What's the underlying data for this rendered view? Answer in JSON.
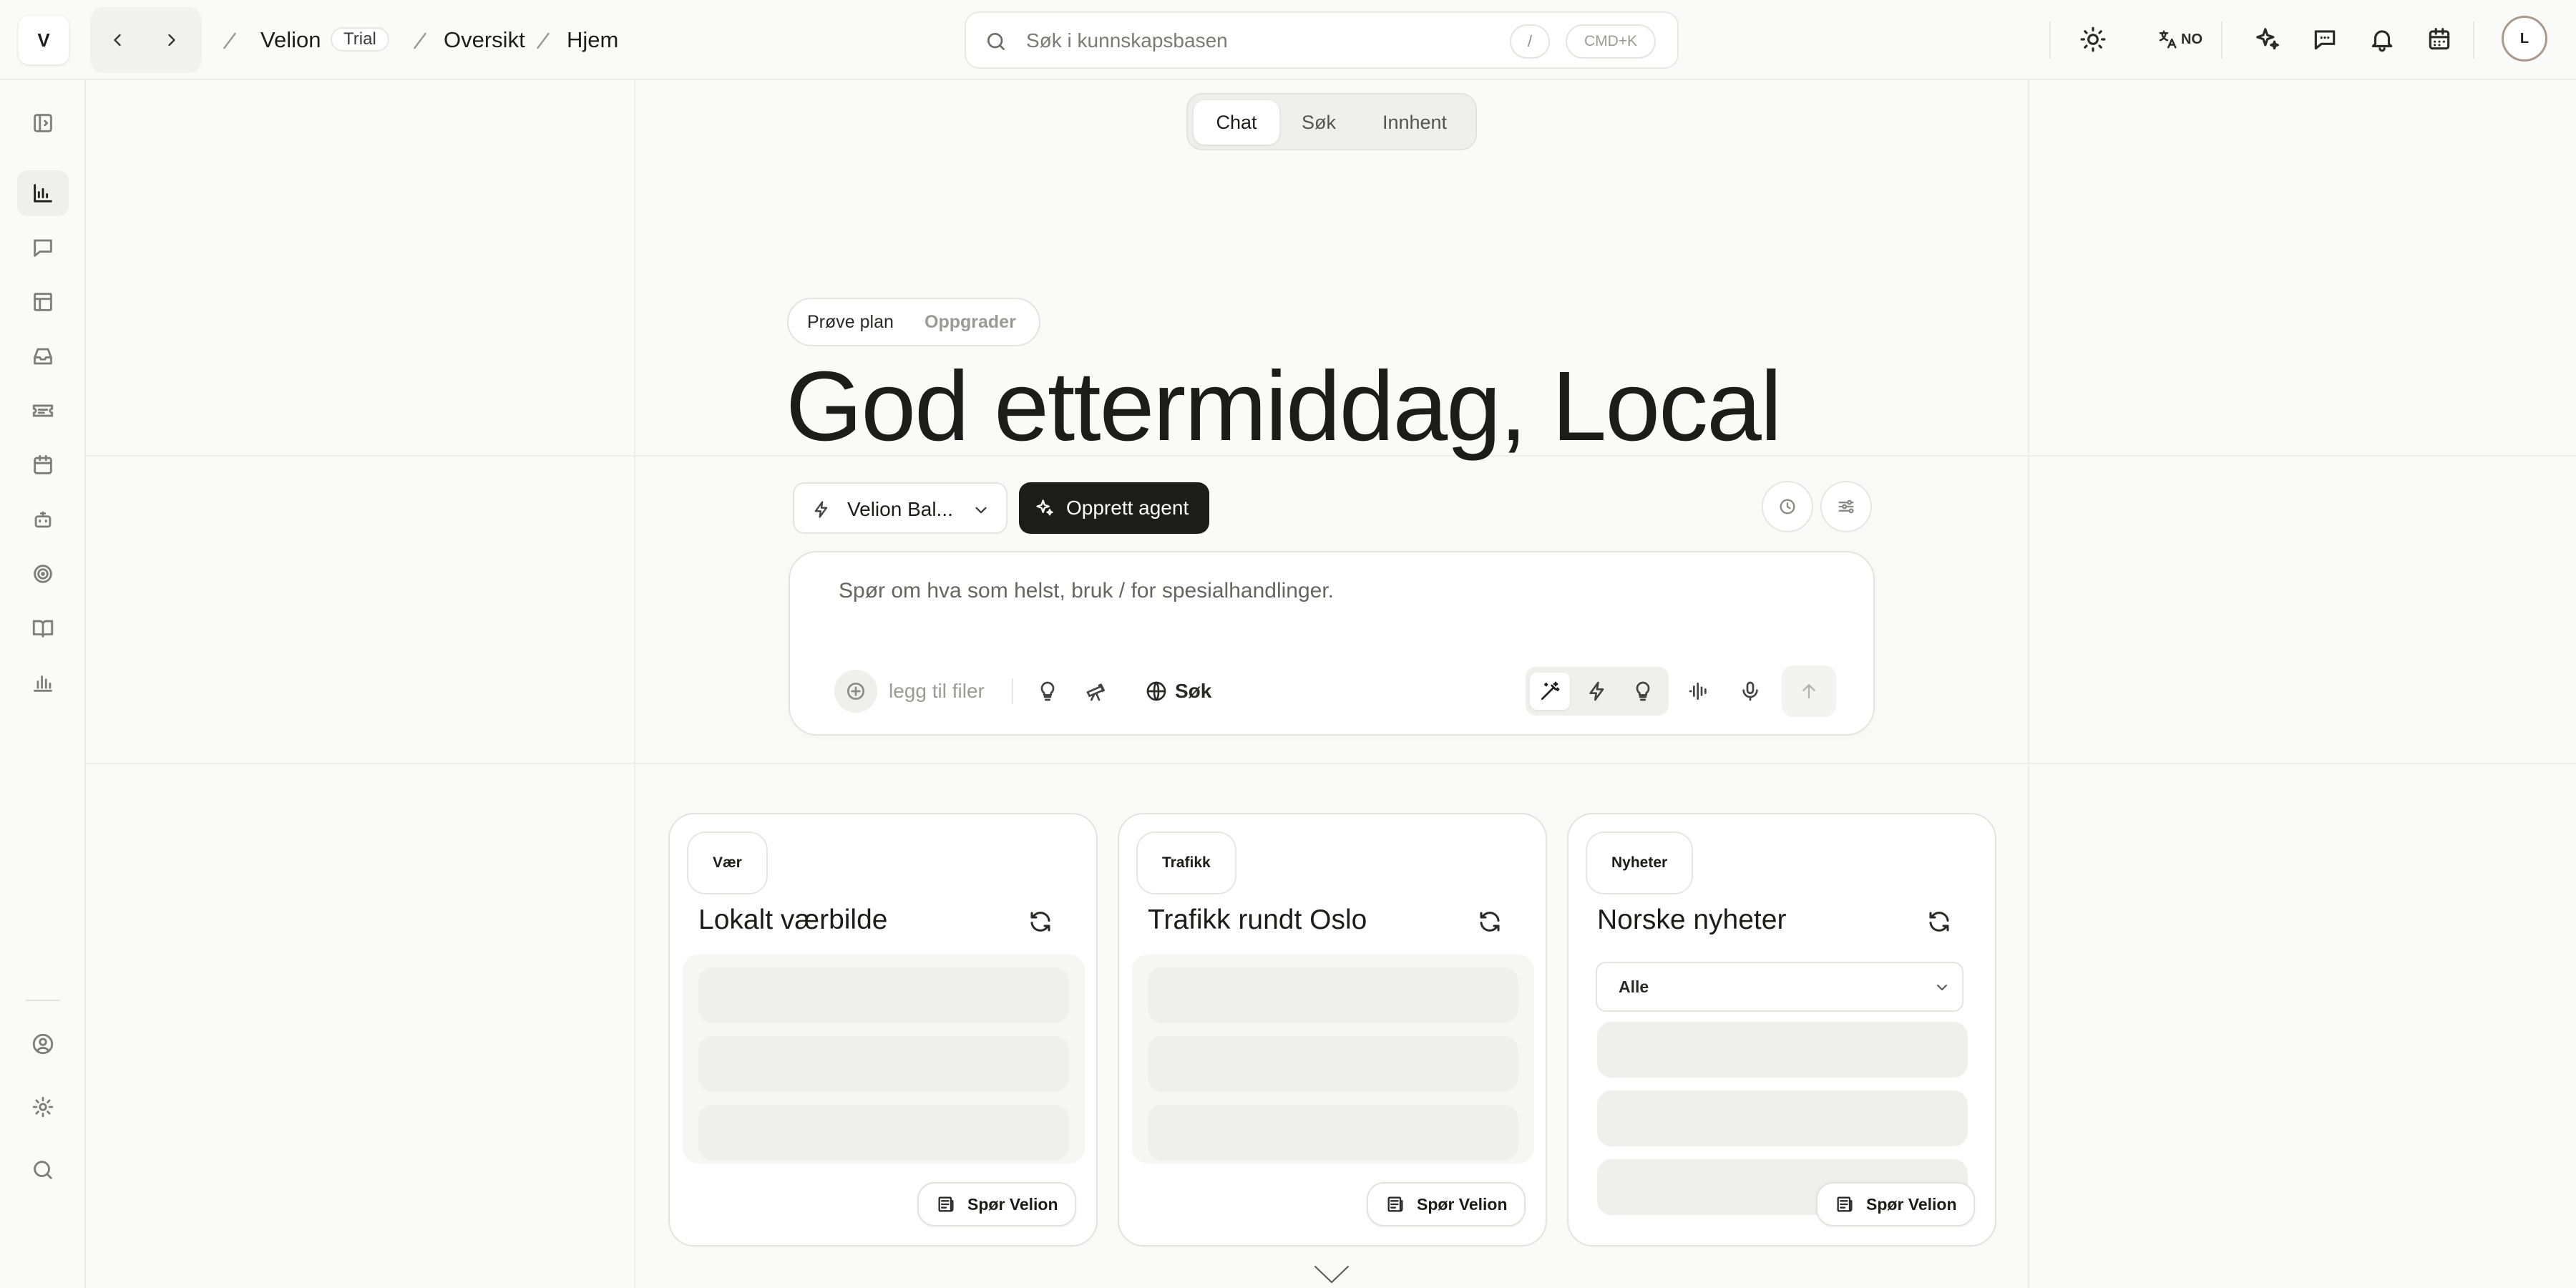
{
  "app": {
    "logo_letter": "V",
    "breadcrumb": {
      "workspace": "Velion",
      "plan_badge": "Trial",
      "section": "Oversikt",
      "page": "Hjem"
    }
  },
  "search": {
    "placeholder": "Søk i kunnskapsbasen",
    "shortcut_slash": "/",
    "shortcut_cmdk": "CMD+K"
  },
  "topbar_icons": [
    "theme-sun-icon",
    "translate-icon",
    "sparkles-icon",
    "chat-bubble-icon",
    "bell-icon",
    "calendar-icon"
  ],
  "language": {
    "code": "NO"
  },
  "user": {
    "avatar_initial": "L"
  },
  "sidebar": {
    "items": [
      "panel-toggle-icon",
      "chart-bar-icon",
      "message-square-icon",
      "table-layout-icon",
      "inbox-icon",
      "ticket-icon",
      "calendar-icon",
      "bot-icon",
      "target-icon",
      "book-open-icon",
      "bar-chart-icon"
    ],
    "active_index": 1,
    "bottom_items": [
      "user-circle-icon",
      "settings-icon",
      "search-icon"
    ]
  },
  "mode_tabs": {
    "items": [
      "Chat",
      "Søk",
      "Innhent"
    ],
    "active": "Chat"
  },
  "plan": {
    "label": "Prøve plan",
    "upgrade": "Oppgrader"
  },
  "greeting": "God ettermiddag, Local",
  "model": {
    "selected": "Velion Bal...",
    "create_agent": "Opprett agent"
  },
  "composer": {
    "placeholder": "Spør om hva som helst, bruk / for spesialhandlinger.",
    "attach_label": "legg til filer",
    "search_label": "Søk"
  },
  "cards": [
    {
      "tag": "Vær",
      "title": "Lokalt værbilde",
      "ask": "Spør Velion"
    },
    {
      "tag": "Trafikk",
      "title": "Trafikk rundt Oslo",
      "ask": "Spør Velion"
    },
    {
      "tag": "Nyheter",
      "title": "Norske nyheter",
      "filter_value": "Alle",
      "ask": "Spør Velion"
    }
  ],
  "colors": {
    "background": "#fafaf9",
    "text": "#1c1c1a",
    "primary_button": "#1c1c1a",
    "border": "#e3e3e0"
  }
}
